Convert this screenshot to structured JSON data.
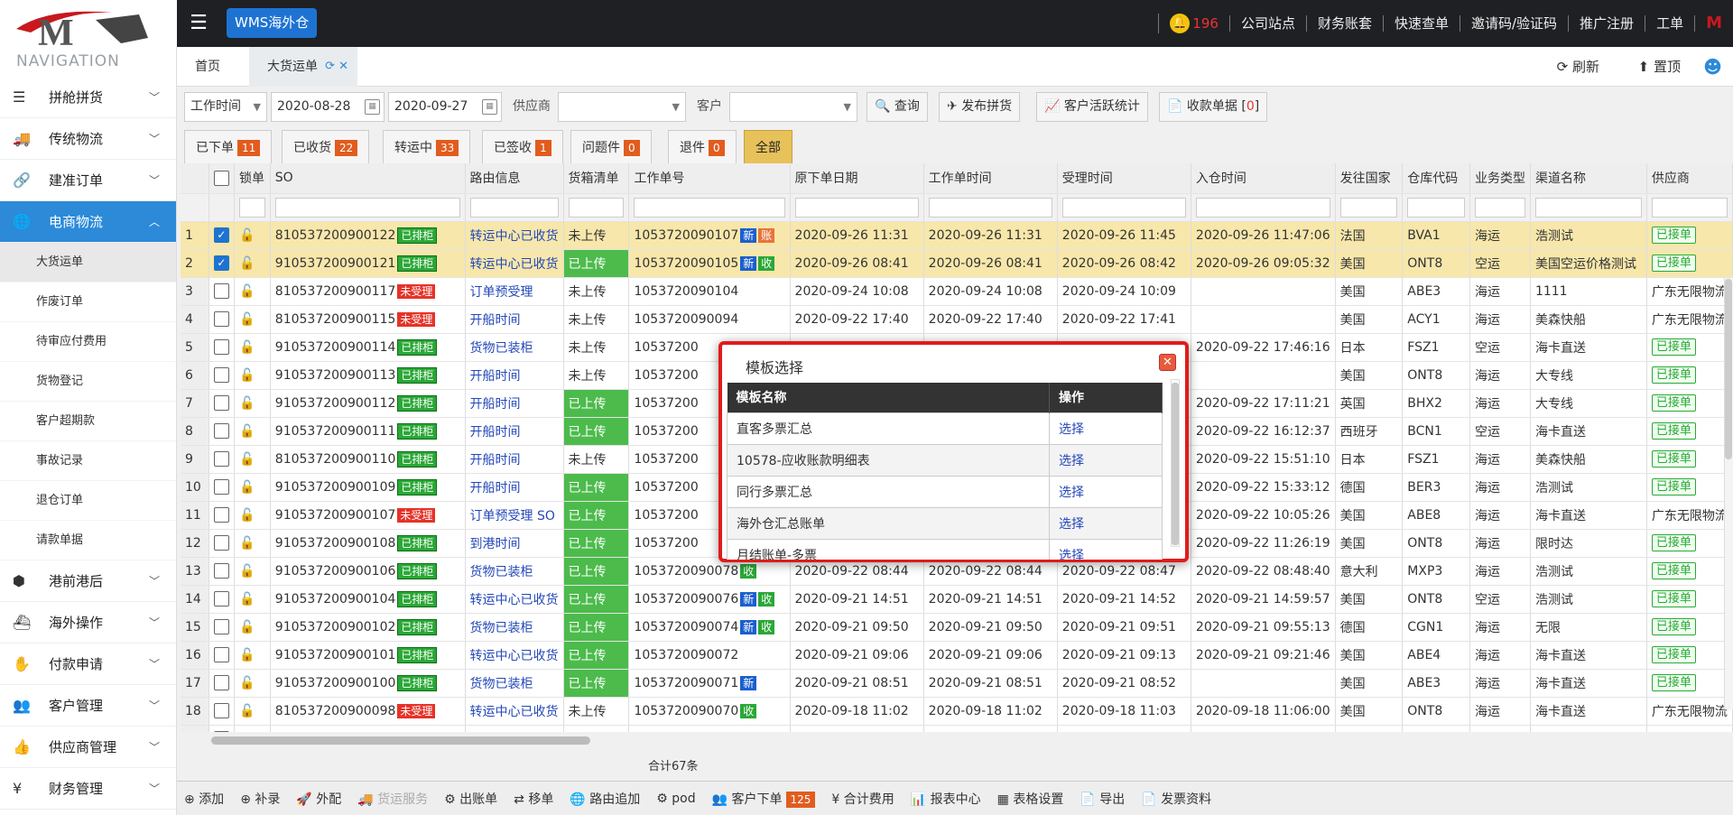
{
  "app": {
    "nav_title": "NAVIGATION",
    "brand_tag": "WMS海外仓",
    "bell_count": "196"
  },
  "topnav": [
    "公司站点",
    "财务账套",
    "快速查单",
    "邀请码/验证码",
    "推广注册",
    "工单"
  ],
  "sidebar": {
    "items": [
      {
        "label": "拼舱拼货",
        "icon": "list-icon"
      },
      {
        "label": "传统物流",
        "icon": "truck-icon"
      },
      {
        "label": "建准订单",
        "icon": "link-icon"
      },
      {
        "label": "电商物流",
        "icon": "globe-icon"
      },
      {
        "label": "港前港后",
        "icon": "cubes-icon"
      },
      {
        "label": "海外操作",
        "icon": "ship-icon"
      },
      {
        "label": "付款申请",
        "icon": "money-icon"
      },
      {
        "label": "客户管理",
        "icon": "users-icon"
      },
      {
        "label": "供应商管理",
        "icon": "thumbs-up-icon"
      },
      {
        "label": "财务管理",
        "icon": "yen-icon"
      }
    ],
    "subitems": [
      "大货运单",
      "作废订单",
      "待审应付费用",
      "货物登记",
      "客户超期款",
      "事故记录",
      "退仓订单",
      "请款单据"
    ]
  },
  "tabs": {
    "home": "首页",
    "cargo": "大货运单",
    "refresh": "刷新",
    "pin": "置顶"
  },
  "toolbar": {
    "date_type": "工作时间",
    "date_from": "2020-08-28",
    "date_to": "2020-09-27",
    "supplier_label": "供应商",
    "customer_label": "客户",
    "query": "查询",
    "publish": "发布拼货",
    "stats": "客户活跃统计",
    "receipt": "收款单据",
    "receipt_count": "0"
  },
  "status": [
    {
      "label": "已下单",
      "count": "11"
    },
    {
      "label": "已收货",
      "count": "22"
    },
    {
      "label": "转运中",
      "count": "33"
    },
    {
      "label": "已签收",
      "count": "1"
    },
    {
      "label": "问题件",
      "count": "0"
    },
    {
      "label": "退件",
      "count": "0"
    },
    {
      "label": "全部",
      "count": ""
    }
  ],
  "grid": {
    "headers": [
      "锁单",
      "SO",
      "路由信息",
      "货箱清单",
      "工作单号",
      "原下单日期",
      "工作单时间",
      "受理时间",
      "入仓时间",
      "发往国家",
      "仓库代码",
      "业务类型",
      "渠道名称",
      "供应商"
    ],
    "rows": [
      {
        "no": "1",
        "checked": true,
        "so": "810537200900122",
        "so_badge": "已排柜",
        "route": "转运中心已收货",
        "box": "未上传",
        "work": "1053720090107",
        "work_badges": [
          "新",
          "账"
        ],
        "orig": "2020-09-26 11:31",
        "wtime": "2020-09-26 11:31",
        "acc": "2020-09-26 11:45",
        "inw": "2020-09-26 11:47:06",
        "country": "法国",
        "wh": "BVA1",
        "type": "海运",
        "channel": "浩测试",
        "sup": "已接单"
      },
      {
        "no": "2",
        "checked": true,
        "so": "910537200900121",
        "so_badge": "已排柜",
        "route": "转运中心已收货",
        "box": "已上传",
        "work": "1053720090105",
        "work_badges": [
          "新",
          "收"
        ],
        "orig": "2020-09-26 08:41",
        "wtime": "2020-09-26 08:41",
        "acc": "2020-09-26 08:42",
        "inw": "2020-09-26 09:05:32",
        "country": "美国",
        "wh": "ONT8",
        "type": "空运",
        "channel": "美国空运价格测试",
        "sup": "已接单"
      },
      {
        "no": "3",
        "checked": false,
        "so": "810537200900117",
        "so_badge": "未受理",
        "route": "订单预受理",
        "box": "未上传",
        "work": "1053720090104",
        "work_badges": [],
        "orig": "2020-09-24 10:08",
        "wtime": "2020-09-24 10:08",
        "acc": "2020-09-24 10:09",
        "inw": "",
        "country": "美国",
        "wh": "ABE3",
        "type": "海运",
        "channel": "1111",
        "sup": "广东无限物流"
      },
      {
        "no": "4",
        "checked": false,
        "so": "810537200900115",
        "so_badge": "未受理",
        "route": "开船时间",
        "box": "未上传",
        "work": "1053720090094",
        "work_badges": [],
        "orig": "2020-09-22 17:40",
        "wtime": "2020-09-22 17:40",
        "acc": "2020-09-22 17:41",
        "inw": "",
        "country": "美国",
        "wh": "ACY1",
        "type": "海运",
        "channel": "美森快船",
        "sup": "广东无限物流"
      },
      {
        "no": "5",
        "checked": false,
        "so": "910537200900114",
        "so_badge": "已排柜",
        "route": "货物已装柜",
        "box": "未上传",
        "work": "10537200",
        "work_badges": [],
        "orig": "",
        "wtime": "",
        "acc": "",
        "inw": "2020-09-22 17:46:16",
        "country": "日本",
        "wh": "FSZ1",
        "type": "空运",
        "channel": "海卡直送",
        "sup": "已接单"
      },
      {
        "no": "6",
        "checked": false,
        "so": "910537200900113",
        "so_badge": "已排柜",
        "route": "开船时间",
        "box": "未上传",
        "work": "10537200",
        "work_badges": [],
        "orig": "",
        "wtime": "",
        "acc": "",
        "inw": "",
        "country": "美国",
        "wh": "ONT8",
        "type": "海运",
        "channel": "大专线",
        "sup": "已接单"
      },
      {
        "no": "7",
        "checked": false,
        "so": "910537200900112",
        "so_badge": "已排柜",
        "route": "开船时间",
        "box": "已上传",
        "work": "10537200",
        "work_badges": [],
        "orig": "",
        "wtime": "",
        "acc": "",
        "inw": "2020-09-22 17:11:21",
        "country": "英国",
        "wh": "BHX2",
        "type": "海运",
        "channel": "大专线",
        "sup": "已接单"
      },
      {
        "no": "8",
        "checked": false,
        "so": "910537200900111",
        "so_badge": "已排柜",
        "route": "开船时间",
        "box": "已上传",
        "work": "10537200",
        "work_badges": [],
        "orig": "",
        "wtime": "",
        "acc": "",
        "inw": "2020-09-22 16:12:37",
        "country": "西班牙",
        "wh": "BCN1",
        "type": "空运",
        "channel": "海卡直送",
        "sup": "已接单"
      },
      {
        "no": "9",
        "checked": false,
        "so": "810537200900110",
        "so_badge": "已排柜",
        "route": "开船时间",
        "box": "未上传",
        "work": "10537200",
        "work_badges": [],
        "orig": "",
        "wtime": "",
        "acc": "",
        "inw": "2020-09-22 15:51:10",
        "country": "日本",
        "wh": "FSZ1",
        "type": "海运",
        "channel": "美森快船",
        "sup": "已接单"
      },
      {
        "no": "10",
        "checked": false,
        "so": "910537200900109",
        "so_badge": "已排柜",
        "route": "开船时间",
        "box": "已上传",
        "work": "10537200",
        "work_badges": [],
        "orig": "",
        "wtime": "",
        "acc": "",
        "inw": "2020-09-22 15:33:12",
        "country": "德国",
        "wh": "BER3",
        "type": "海运",
        "channel": "浩测试",
        "sup": "已接单"
      },
      {
        "no": "11",
        "checked": false,
        "so": "910537200900107",
        "so_badge": "未受理",
        "route": "订单预受理 SO",
        "box": "已上传",
        "work": "10537200",
        "work_badges": [],
        "orig": "",
        "wtime": "",
        "acc": "",
        "inw": "2020-09-22 10:05:26",
        "country": "美国",
        "wh": "ABE8",
        "type": "海运",
        "channel": "海卡直送",
        "sup": "广东无限物流"
      },
      {
        "no": "12",
        "checked": false,
        "so": "910537200900108",
        "so_badge": "已排柜",
        "route": "到港时间",
        "box": "已上传",
        "work": "10537200",
        "work_badges": [],
        "orig": "",
        "wtime": "",
        "acc": "",
        "inw": "2020-09-22 11:26:19",
        "country": "美国",
        "wh": "ONT8",
        "type": "海运",
        "channel": "限时达",
        "sup": "已接单"
      },
      {
        "no": "13",
        "checked": false,
        "so": "910537200900106",
        "so_badge": "已排柜",
        "route": "货物已装柜",
        "box": "已上传",
        "work": "1053720090078",
        "work_badges": [
          "收"
        ],
        "orig": "2020-09-22 08:44",
        "wtime": "2020-09-22 08:44",
        "acc": "2020-09-22 08:47",
        "inw": "2020-09-22 08:48:40",
        "country": "意大利",
        "wh": "MXP3",
        "type": "海运",
        "channel": "浩测试",
        "sup": "已接单"
      },
      {
        "no": "14",
        "checked": false,
        "so": "910537200900104",
        "so_badge": "已排柜",
        "route": "转运中心已收货",
        "box": "已上传",
        "work": "1053720090076",
        "work_badges": [
          "新",
          "收"
        ],
        "orig": "2020-09-21 14:51",
        "wtime": "2020-09-21 14:51",
        "acc": "2020-09-21 14:52",
        "inw": "2020-09-21 14:59:57",
        "country": "美国",
        "wh": "ONT8",
        "type": "空运",
        "channel": "浩测试",
        "sup": "已接单"
      },
      {
        "no": "15",
        "checked": false,
        "so": "910537200900102",
        "so_badge": "已排柜",
        "route": "货物已装柜",
        "box": "已上传",
        "work": "1053720090074",
        "work_badges": [
          "新",
          "收"
        ],
        "orig": "2020-09-21 09:50",
        "wtime": "2020-09-21 09:50",
        "acc": "2020-09-21 09:51",
        "inw": "2020-09-21 09:55:13",
        "country": "德国",
        "wh": "CGN1",
        "type": "海运",
        "channel": "无限",
        "sup": "已接单"
      },
      {
        "no": "16",
        "checked": false,
        "so": "910537200900101",
        "so_badge": "已排柜",
        "route": "转运中心已收货",
        "box": "已上传",
        "work": "1053720090072",
        "work_badges": [],
        "orig": "2020-09-21 09:06",
        "wtime": "2020-09-21 09:06",
        "acc": "2020-09-21 09:13",
        "inw": "2020-09-21 09:21:46",
        "country": "美国",
        "wh": "ABE4",
        "type": "海运",
        "channel": "海卡直送",
        "sup": "已接单"
      },
      {
        "no": "17",
        "checked": false,
        "so": "910537200900100",
        "so_badge": "已排柜",
        "route": "货物已装柜",
        "box": "已上传",
        "work": "1053720090071",
        "work_badges": [
          "新"
        ],
        "orig": "2020-09-21 08:51",
        "wtime": "2020-09-21 08:51",
        "acc": "2020-09-21 08:52",
        "inw": "",
        "country": "美国",
        "wh": "ABE3",
        "type": "海运",
        "channel": "海卡直送",
        "sup": "已接单"
      },
      {
        "no": "18",
        "checked": false,
        "so": "810537200900098",
        "so_badge": "未受理",
        "route": "转运中心已收货",
        "box": "未上传",
        "work": "1053720090070",
        "work_badges": [
          "收"
        ],
        "orig": "2020-09-18 11:02",
        "wtime": "2020-09-18 11:02",
        "acc": "2020-09-18 11:03",
        "inw": "2020-09-18 11:06:00",
        "country": "美国",
        "wh": "ONT8",
        "type": "海运",
        "channel": "海卡直送",
        "sup": "广东无限物流"
      },
      {
        "no": "19",
        "checked": false,
        "so": "",
        "so_badge": "",
        "route": "",
        "box": "",
        "work": "",
        "work_badges": [],
        "orig": "",
        "wtime": "",
        "acc": "",
        "inw": "",
        "country": "",
        "wh": "",
        "type": "",
        "channel": "",
        "sup": ""
      }
    ],
    "total": "合计67条"
  },
  "footer": [
    {
      "label": "添加",
      "icon": "plus-circle-icon",
      "disabled": false
    },
    {
      "label": "补录",
      "icon": "plus-circle-icon",
      "disabled": false
    },
    {
      "label": "外配",
      "icon": "rocket-icon",
      "disabled": false
    },
    {
      "label": "货运服务",
      "icon": "truck-icon",
      "disabled": true
    },
    {
      "label": "出账单",
      "icon": "gear-icon",
      "disabled": false
    },
    {
      "label": "移单",
      "icon": "transfer-icon",
      "disabled": false
    },
    {
      "label": "路由追加",
      "icon": "globe-icon",
      "disabled": false
    },
    {
      "label": "pod",
      "icon": "gear-icon",
      "disabled": false
    },
    {
      "label": "客户下单",
      "icon": "users-icon",
      "disabled": false,
      "count": "125"
    },
    {
      "label": "合计费用",
      "icon": "yen-icon",
      "disabled": false
    },
    {
      "label": "报表中心",
      "icon": "bar-chart-icon",
      "disabled": false
    },
    {
      "label": "表格设置",
      "icon": "table-icon",
      "disabled": false
    },
    {
      "label": "导出",
      "icon": "file-icon",
      "disabled": false
    },
    {
      "label": "发票资料",
      "icon": "file-icon",
      "disabled": false
    }
  ],
  "modal": {
    "title": "模板选择",
    "col_name": "模板名称",
    "col_op": "操作",
    "rows": [
      {
        "name": "直客多票汇总",
        "op": "选择"
      },
      {
        "name": "10578-应收账款明细表",
        "op": "选择"
      },
      {
        "name": "同行多票汇总",
        "op": "选择"
      },
      {
        "name": "海外仓汇总账单",
        "op": "选择"
      },
      {
        "name": "月结账单-多票",
        "op": "选择"
      }
    ]
  }
}
